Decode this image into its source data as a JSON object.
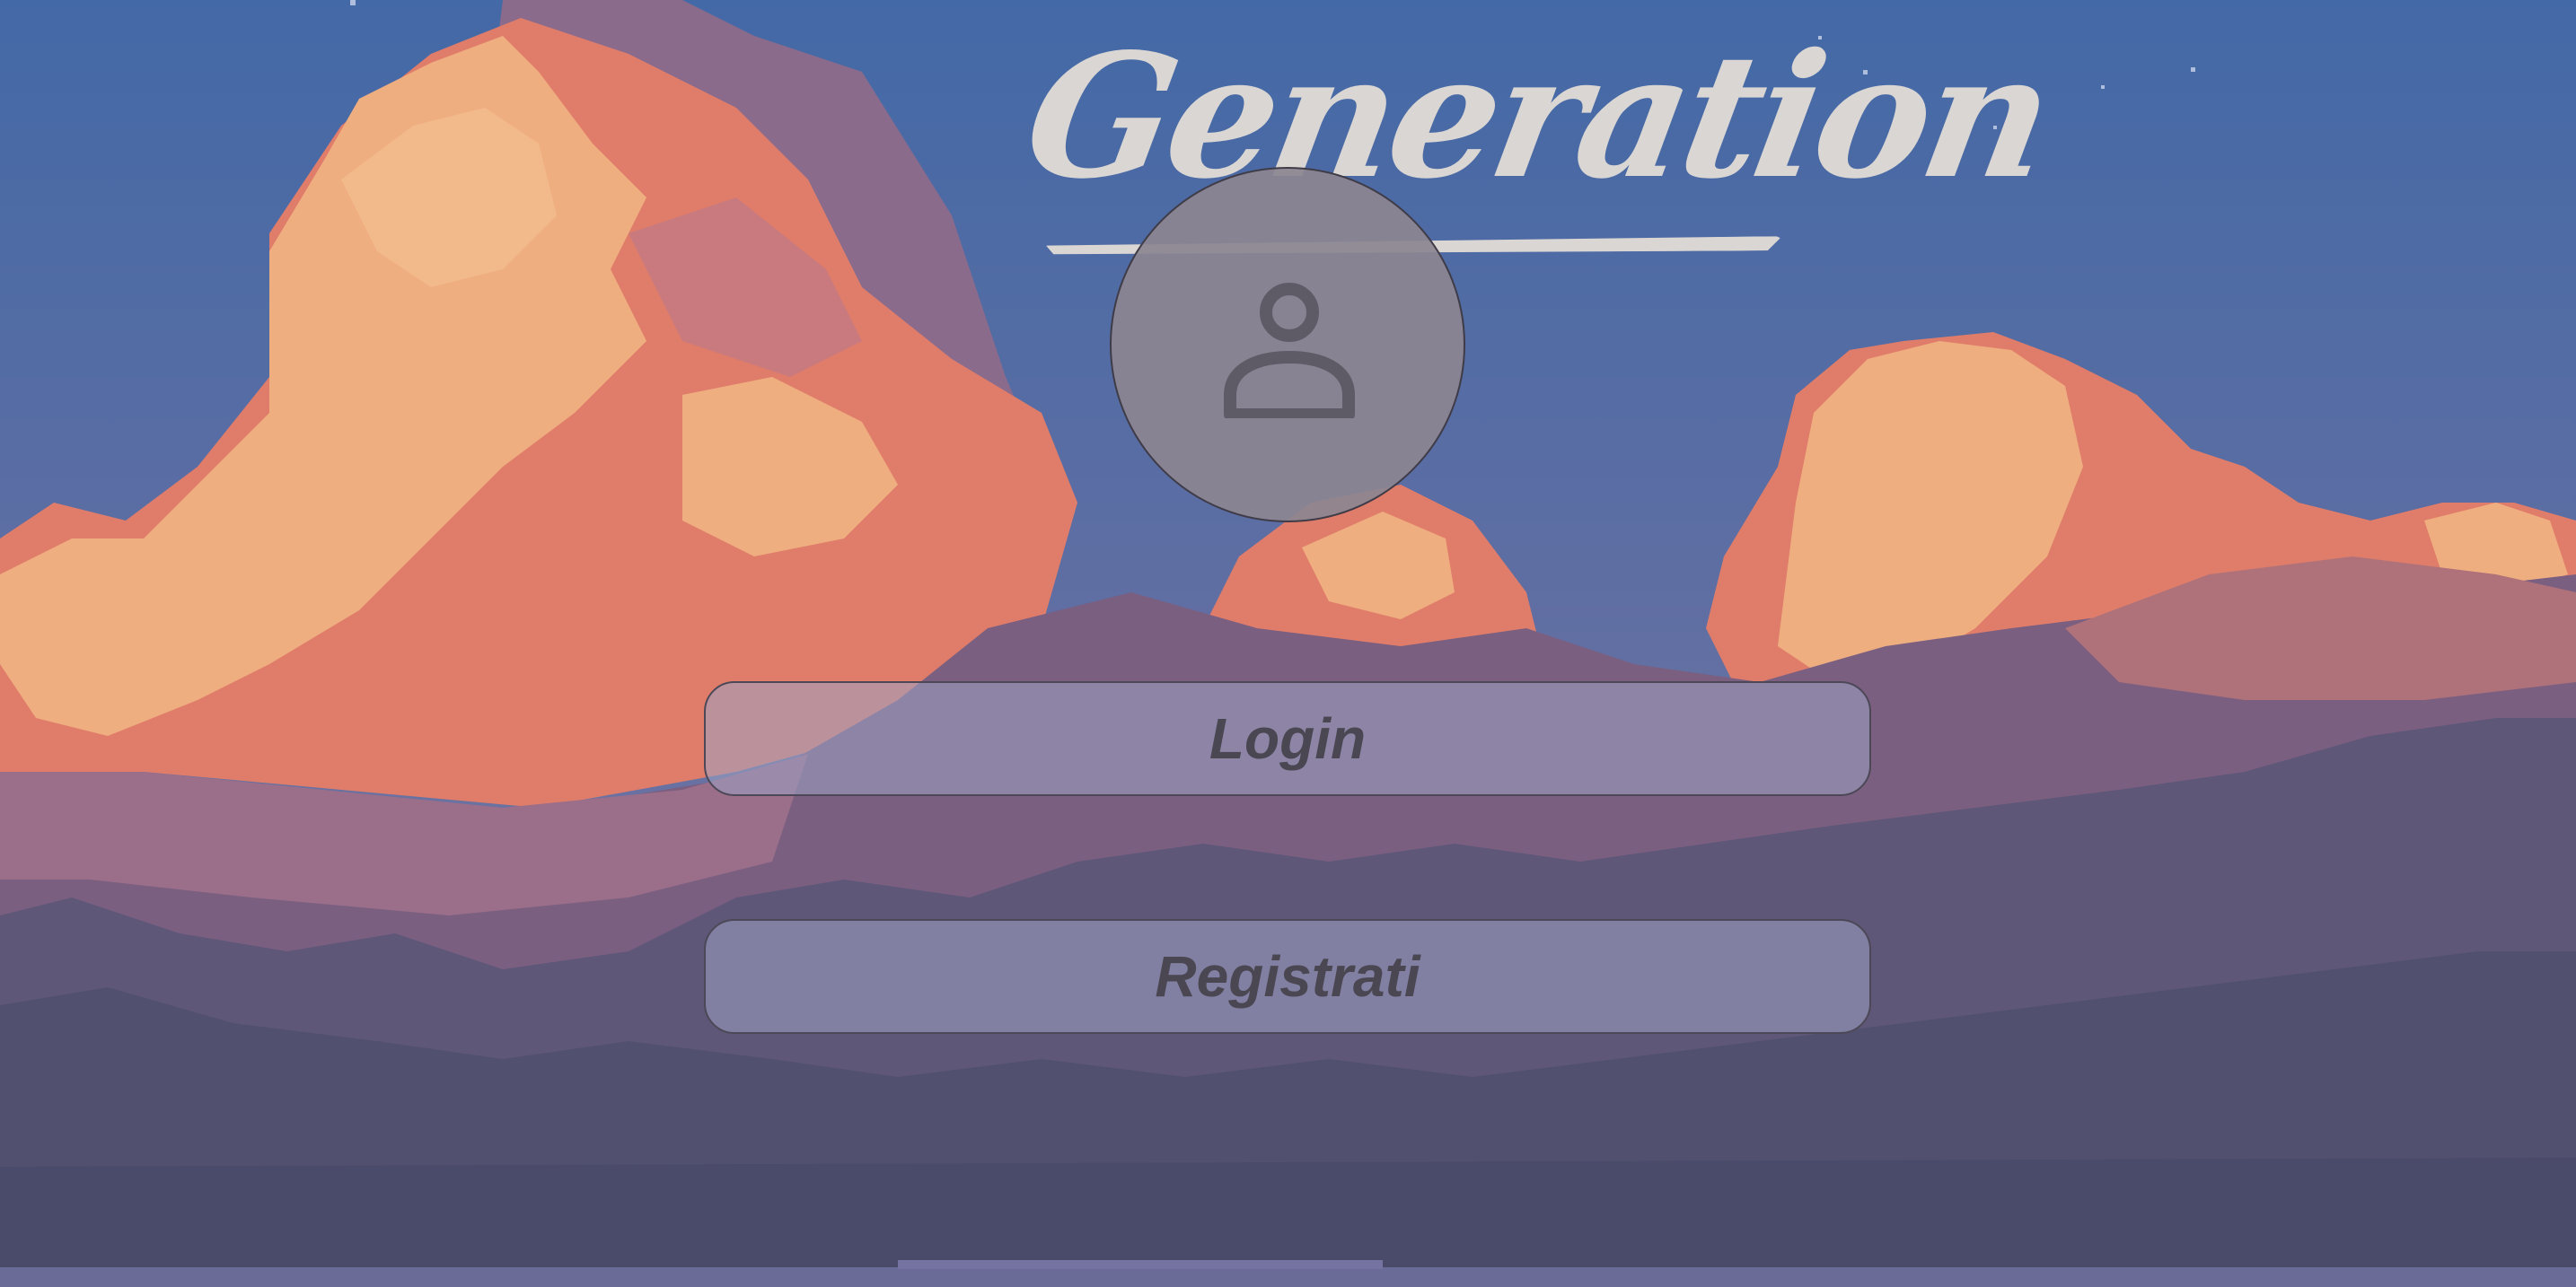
{
  "app": {
    "title": "Generation"
  },
  "avatar": {
    "icon": "user-icon"
  },
  "actions": {
    "login_label": "Login",
    "register_label": "Registrati"
  },
  "colors": {
    "sky_top": "#4369a6",
    "sky_mid": "#6c72a0",
    "cloud_light": "#efae80",
    "cloud_orange": "#e07d6a",
    "cloud_purple": "#8a6b8c",
    "cloud_dark": "#51506f",
    "title": "#dad6d3",
    "button_text": "#4a4752"
  }
}
